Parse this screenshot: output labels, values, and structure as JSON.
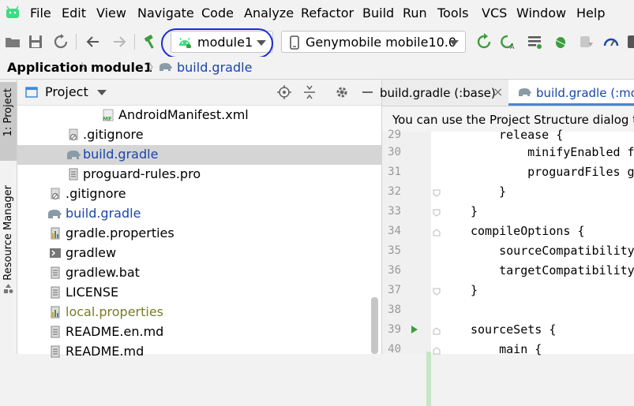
{
  "menu": {
    "items": [
      "File",
      "Edit",
      "View",
      "Navigate",
      "Code",
      "Analyze",
      "Refactor",
      "Build",
      "Run",
      "Tools",
      "VCS",
      "Window",
      "Help"
    ]
  },
  "toolbar": {
    "module_selector": "module1",
    "device_selector": "Genymobile mobile10.0"
  },
  "breadcrumb": {
    "items": [
      "Application",
      "module1",
      "build.gradle"
    ]
  },
  "side_strip": {
    "project_tab": "1: Project",
    "resource_manager_tab": "Resource Manager"
  },
  "project_panel": {
    "title": "Project",
    "tree": [
      {
        "label": "AndroidManifest.xml",
        "icon": "manifest-icon",
        "color": "#000000"
      },
      {
        "label": ".gitignore",
        "icon": "gitignore-icon",
        "color": "#000000"
      },
      {
        "label": "build.gradle",
        "icon": "gradle-elephant-icon",
        "color": "#1a45a8",
        "selected": true
      },
      {
        "label": "proguard-rules.pro",
        "icon": "text-file-icon",
        "color": "#000000"
      },
      {
        "label": ".gitignore",
        "icon": "gitignore-icon",
        "color": "#000000"
      },
      {
        "label": "build.gradle",
        "icon": "gradle-elephant-icon",
        "color": "#1a45a8"
      },
      {
        "label": "gradle.properties",
        "icon": "properties-icon",
        "color": "#000000"
      },
      {
        "label": "gradlew",
        "icon": "shell-script-icon",
        "color": "#000000"
      },
      {
        "label": "gradlew.bat",
        "icon": "text-file-icon",
        "color": "#000000"
      },
      {
        "label": "LICENSE",
        "icon": "text-file-icon",
        "color": "#000000"
      },
      {
        "label": "local.properties",
        "icon": "properties-icon",
        "color": "#7a7a2a"
      },
      {
        "label": "README.en.md",
        "icon": "text-file-icon",
        "color": "#000000"
      },
      {
        "label": "README.md",
        "icon": "text-file-icon",
        "color": "#000000"
      }
    ]
  },
  "editor": {
    "tabs": [
      {
        "label": "build.gradle (:base)",
        "active": false
      },
      {
        "label": "build.gradle (:mo",
        "active": true
      }
    ],
    "banner": "You can use the Project Structure dialog to",
    "lines": [
      {
        "num": "29",
        "text": "release {"
      },
      {
        "num": "30",
        "text": "    minifyEnabled f"
      },
      {
        "num": "31",
        "text": "    proguardFiles g"
      },
      {
        "num": "32",
        "text": "}"
      },
      {
        "num": "33",
        "text": "}"
      },
      {
        "num": "34",
        "text": "compileOptions {"
      },
      {
        "num": "35",
        "text": "    sourceCompatibility"
      },
      {
        "num": "36",
        "text": "    targetCompatibility"
      },
      {
        "num": "37",
        "text": "}"
      },
      {
        "num": "38",
        "text": ""
      },
      {
        "num": "39",
        "text": "sourceSets {"
      },
      {
        "num": "40",
        "text": "    main {"
      }
    ]
  },
  "colors": {
    "accent_blue": "#1a45a8",
    "android_green": "#3ddc84",
    "run_green": "#3c9d3c",
    "annotation_circle": "#1a2ad6"
  }
}
